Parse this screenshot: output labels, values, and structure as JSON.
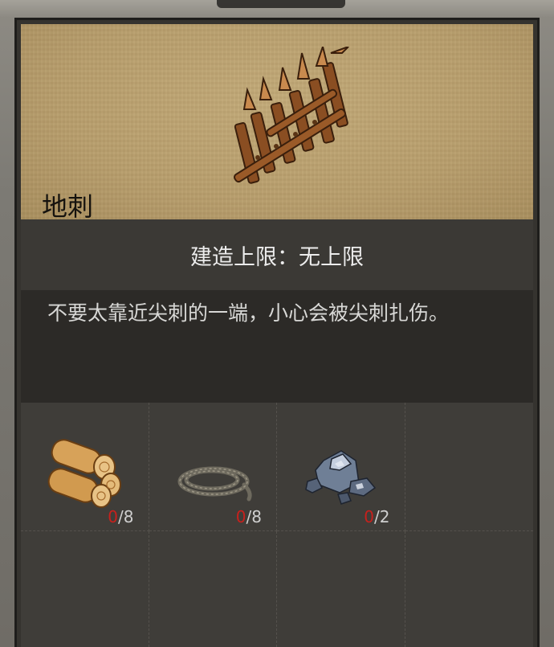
{
  "item": {
    "name": "地刺",
    "icon": "spike-fence-icon",
    "build_limit": "建造上限：无上限",
    "description": "不要太靠近尖刺的一端，小心会被尖刺扎伤。"
  },
  "materials": [
    {
      "name": "wood-logs",
      "icon": "wood-logs-icon",
      "have": "0",
      "need": "/8"
    },
    {
      "name": "rope",
      "icon": "rope-icon",
      "have": "0",
      "need": "/8"
    },
    {
      "name": "ore",
      "icon": "ore-icon",
      "have": "0",
      "need": "/2"
    }
  ],
  "colors": {
    "have_insufficient": "#c8201c",
    "preview_bg": "#b89e6c",
    "panel_bg": "#35332f"
  }
}
